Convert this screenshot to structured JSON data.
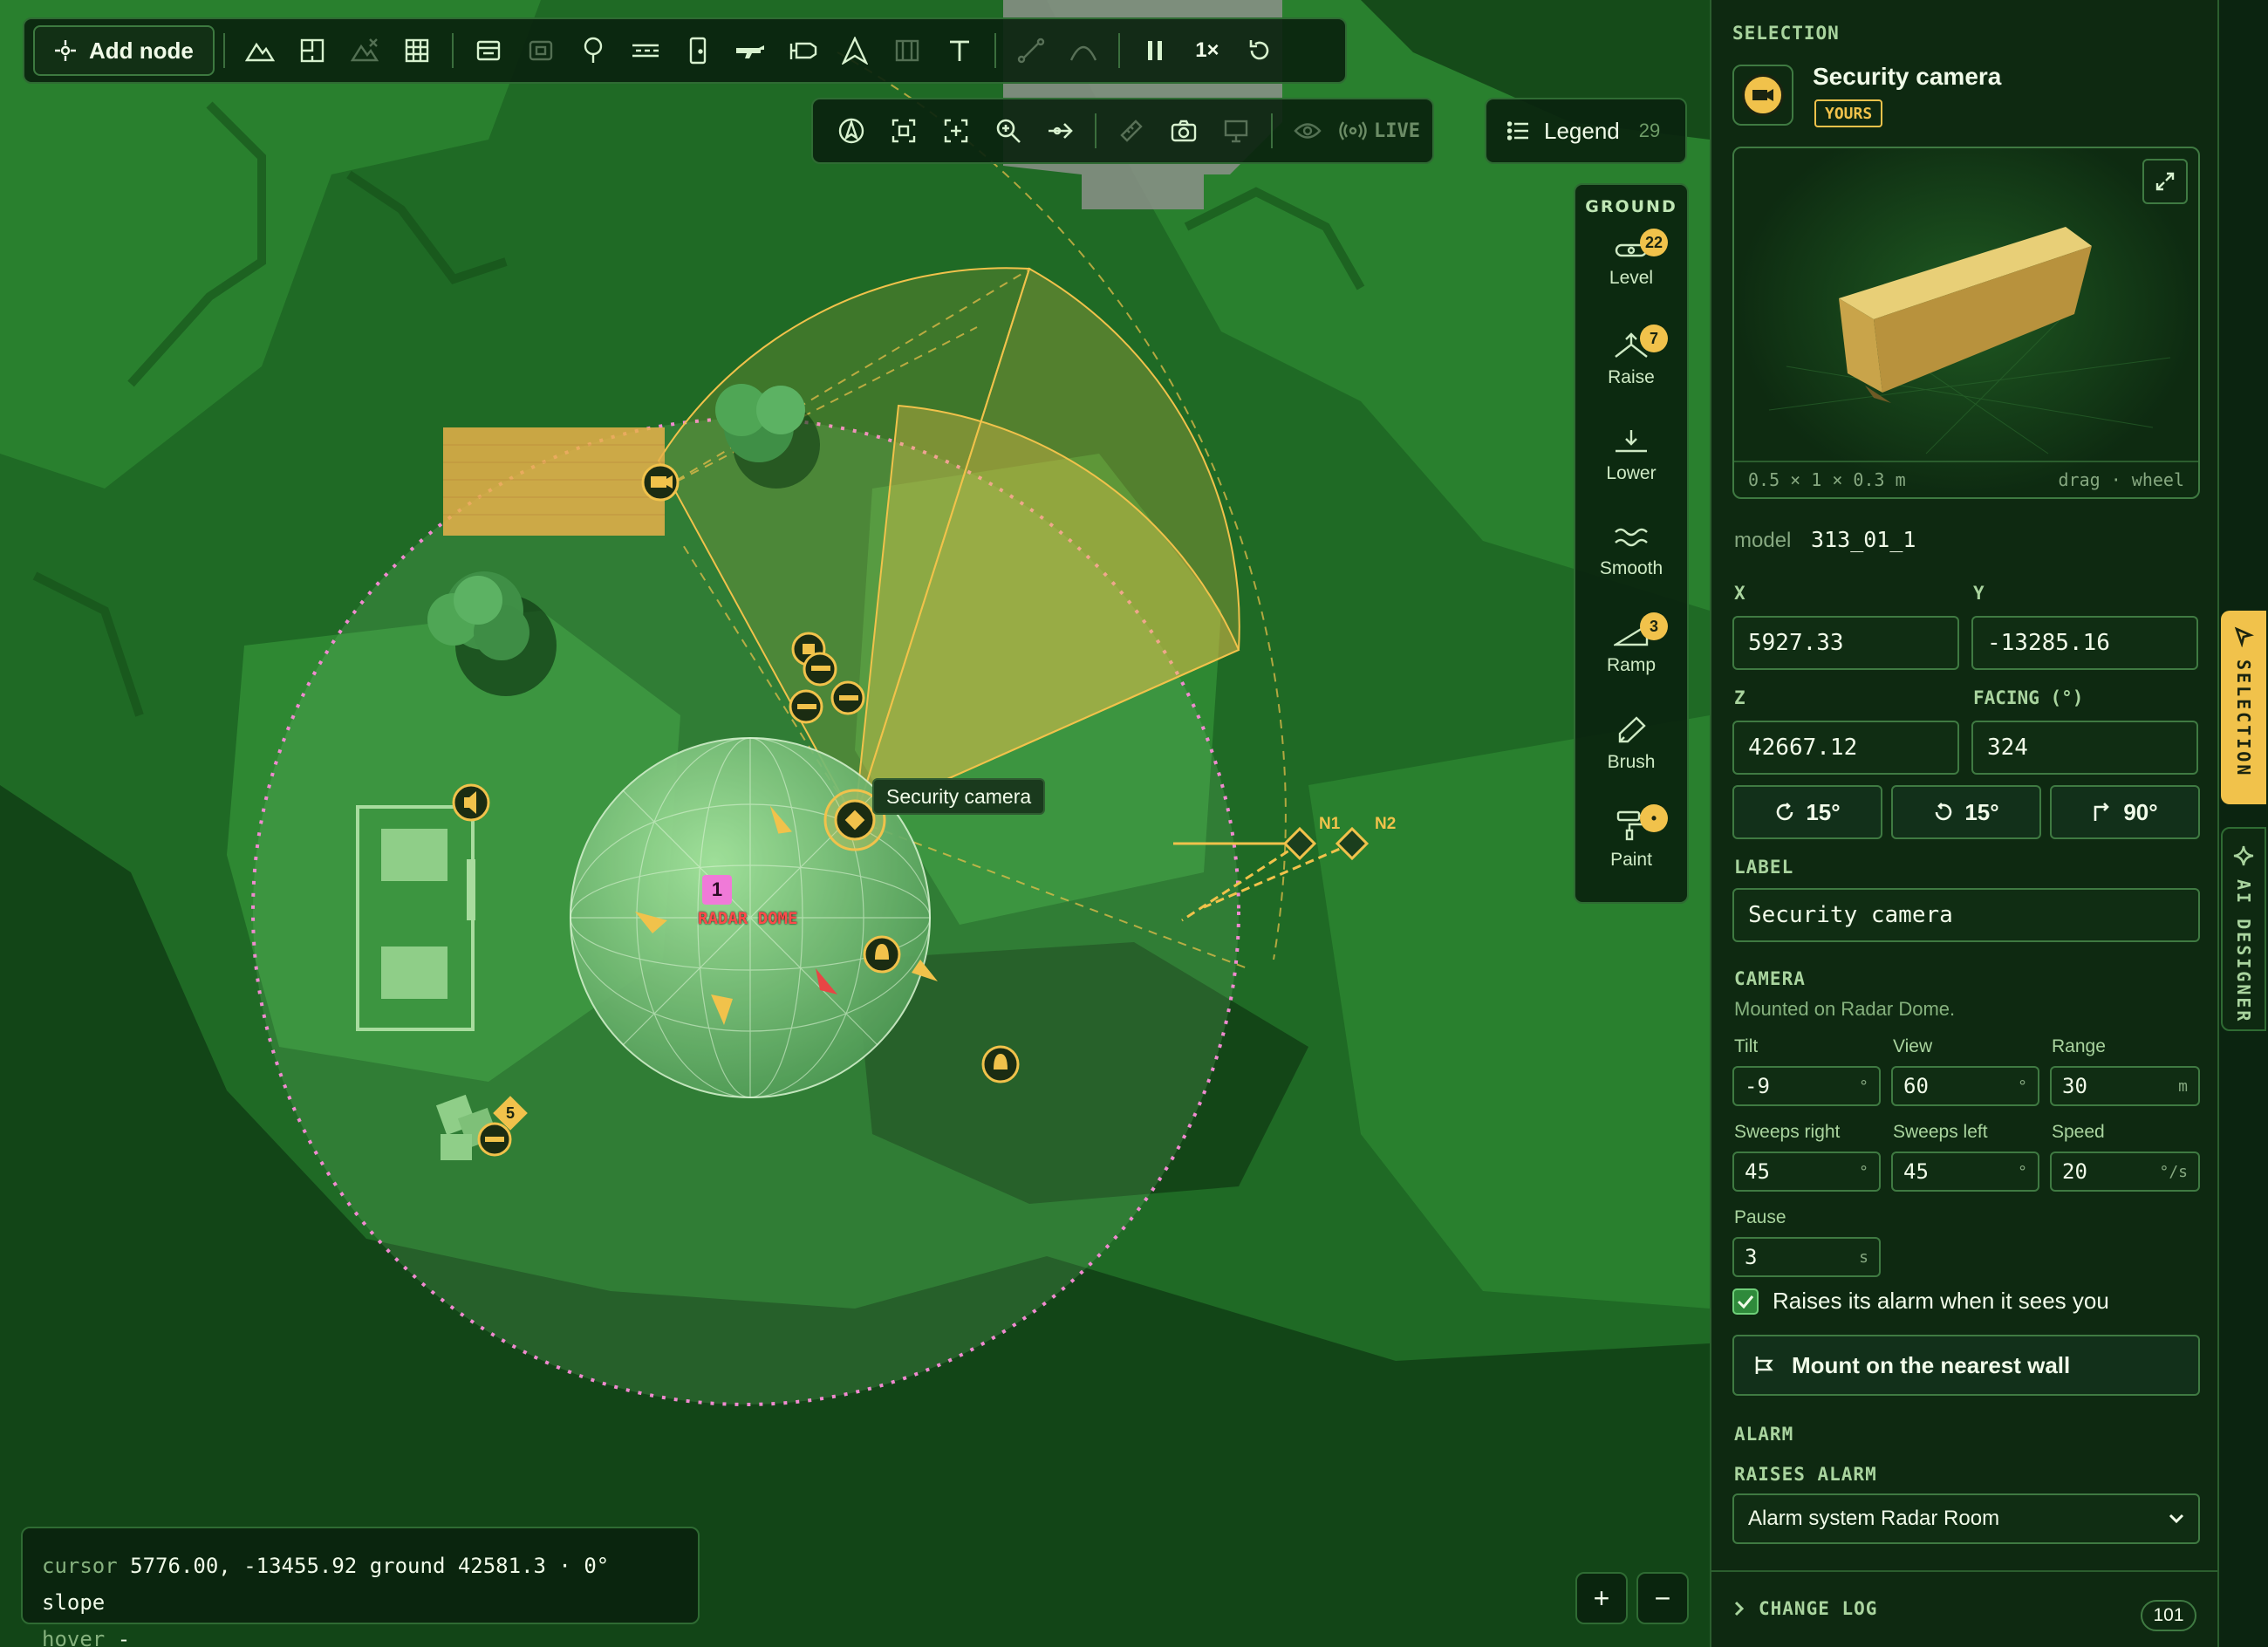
{
  "toolbar": {
    "add_node_label": "Add node",
    "speed_label": "1×"
  },
  "view_toolbar": {
    "live_label": "LIVE"
  },
  "legend": {
    "label": "Legend",
    "count": "29"
  },
  "ground": {
    "title": "GROUND",
    "tools": [
      {
        "label": "Level",
        "badge": "22"
      },
      {
        "label": "Raise",
        "badge": "7"
      },
      {
        "label": "Lower",
        "badge": ""
      },
      {
        "label": "Smooth",
        "badge": ""
      },
      {
        "label": "Ramp",
        "badge": "3"
      },
      {
        "label": "Brush",
        "badge": ""
      },
      {
        "label": "Paint",
        "badge": "•"
      }
    ]
  },
  "map": {
    "camera_tooltip": "Security camera",
    "radar_dome_label": "RADAR DOME",
    "radar_dome_marker": "1",
    "group_count": "5",
    "node_n1": "N1",
    "node_n2": "N2"
  },
  "status": {
    "cursor_key": "cursor",
    "cursor_value": "5776.00, -13455.92 ground 42581.3 · 0° slope",
    "hover_key": "hover",
    "hover_value": "-"
  },
  "zoom": {
    "in": "+",
    "out": "−"
  },
  "selection": {
    "section_title": "SELECTION",
    "name": "Security camera",
    "owner_badge": "YOURS",
    "preview_dims": "0.5 × 1 × 0.3 m",
    "preview_hint": "drag · wheel",
    "model_key": "model",
    "model_value": "313_01_1",
    "x_label": "X",
    "x_value": "5927.33",
    "y_label": "Y",
    "y_value": "-13285.16",
    "z_label": "Z",
    "z_value": "42667.12",
    "facing_label": "FACING (°)",
    "facing_value": "324",
    "rotate_cw": "15°",
    "rotate_ccw": "15°",
    "rotate_90": "90°",
    "label_title": "LABEL",
    "label_value": "Security camera",
    "camera_title": "CAMERA",
    "camera_mount": "Mounted on Radar Dome.",
    "tilt_label": "Tilt",
    "tilt_value": "-9",
    "tilt_unit": "°",
    "view_label": "View",
    "view_value": "60",
    "view_unit": "°",
    "range_label": "Range",
    "range_value": "30",
    "range_unit": "m",
    "sweeps_right_label": "Sweeps right",
    "sweeps_right_value": "45",
    "sweeps_right_unit": "°",
    "sweeps_left_label": "Sweeps left",
    "sweeps_left_value": "45",
    "sweeps_left_unit": "°",
    "speed_label": "Speed",
    "speed_value": "20",
    "speed_unit": "°/s",
    "pause_label": "Pause",
    "pause_value": "3",
    "pause_unit": "s",
    "alarm_checkbox_label": "Raises its alarm when it sees you",
    "alarm_checked": true,
    "mount_button": "Mount on the nearest wall",
    "alarm_title": "ALARM",
    "raises_alarm_title": "RAISES ALARM",
    "raises_alarm_value": "Alarm system Radar Room",
    "change_log_label": "CHANGE LOG",
    "change_log_count": "101"
  },
  "right_tabs": {
    "selection": "SELECTION",
    "ai_designer": "AI DESIGNER"
  },
  "colors": {
    "accent": "#f1c24b",
    "panel_bg": "#0e2911",
    "border": "#3f7a42",
    "radius_ring": "#f08ad0"
  }
}
